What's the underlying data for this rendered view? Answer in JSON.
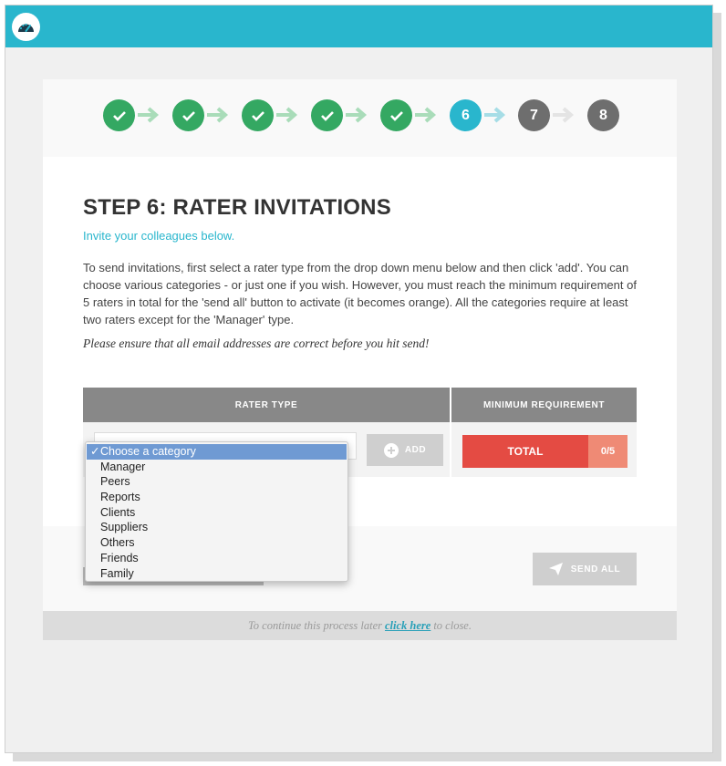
{
  "steps": [
    {
      "label": "",
      "state": "done"
    },
    {
      "label": "",
      "state": "done"
    },
    {
      "label": "",
      "state": "done"
    },
    {
      "label": "",
      "state": "done"
    },
    {
      "label": "",
      "state": "done"
    },
    {
      "label": "6",
      "state": "current"
    },
    {
      "label": "7",
      "state": "todo"
    },
    {
      "label": "8",
      "state": "todo"
    }
  ],
  "page": {
    "title": "STEP 6: RATER INVITATIONS",
    "subtitle": "Invite your colleagues below.",
    "description": "To send invitations, first select a rater type from the drop down menu below and then click 'add'. You can choose various categories - or just one if you wish. However, you must reach the minimum requirement of 5 raters in total for the 'send all' button to activate (it becomes orange). All the categories require at least two raters except for the 'Manager' type.",
    "warning": "Please ensure that all email addresses are correct before you hit send!"
  },
  "table": {
    "col_rater_type": "RATER TYPE",
    "col_min_req": "MINIMUM REQUIREMENT",
    "add_label": "ADD",
    "total_label": "TOTAL",
    "total_count": "0/5"
  },
  "dropdown": {
    "check_glyph": "✓",
    "selected": "Choose a category",
    "options": [
      "Manager",
      "Peers",
      "Reports",
      "Clients",
      "Suppliers",
      "Others",
      "Friends",
      "Family"
    ]
  },
  "footer": {
    "send_all_label": "SEND ALL",
    "later_prefix": "To continue this process later",
    "later_link": "click here",
    "later_suffix": "to close."
  },
  "colors": {
    "brand": "#29b6cd",
    "done": "#34a862",
    "todo": "#6e6e6e",
    "danger": "#e44b43"
  }
}
